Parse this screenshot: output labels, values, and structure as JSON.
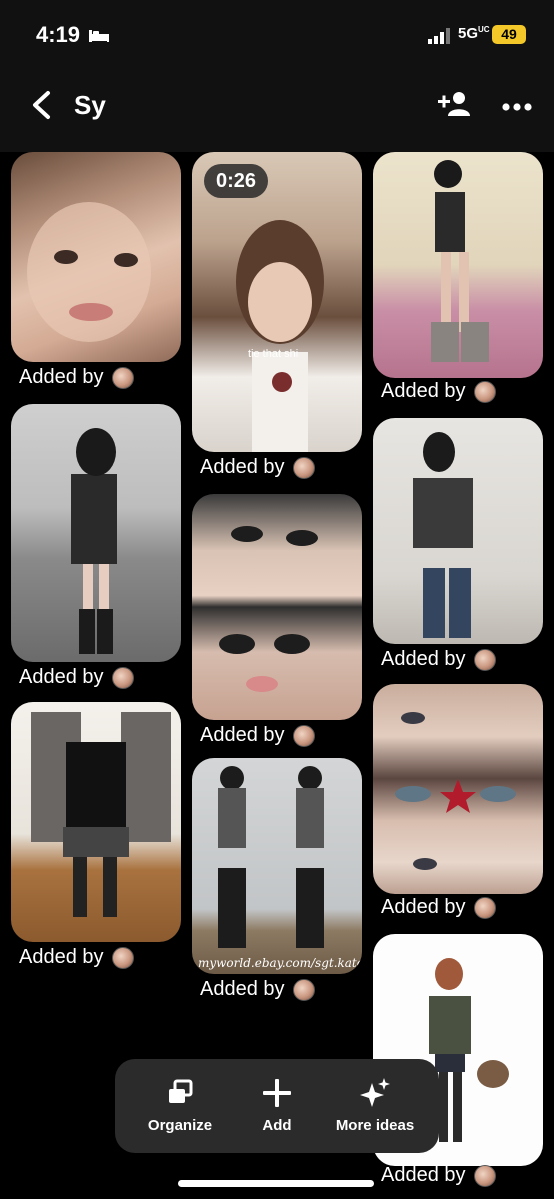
{
  "status": {
    "time": "4:19",
    "network": "5G",
    "network_sup": "UC",
    "battery": "49"
  },
  "header": {
    "title": "Sy"
  },
  "pins": {
    "added_by": "Added by",
    "video_duration": "0:26",
    "video_overlay_text": "tie that shi",
    "watermark": "myworld.ebay.com/sgt.kato"
  },
  "toolbar": {
    "organize": "Organize",
    "add": "Add",
    "more_ideas": "More ideas"
  }
}
